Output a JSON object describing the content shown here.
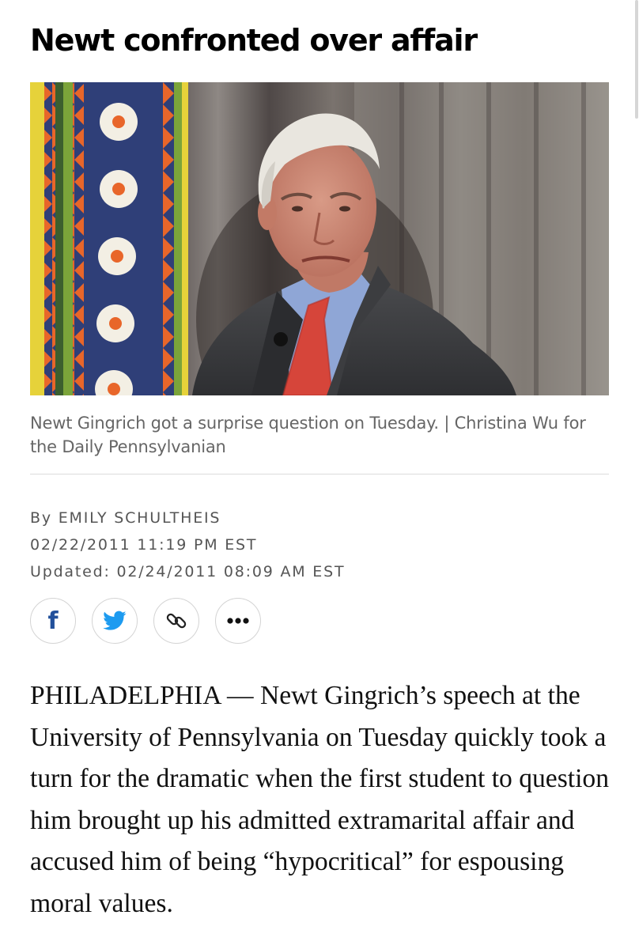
{
  "article": {
    "headline": "Newt confronted over affair",
    "image_alt": "Newt Gingrich speaking",
    "caption": "Newt Gingrich got a surprise question on Tuesday. | Christina Wu for the Daily Pennsylvanian",
    "byline": "By EMILY SCHULTHEIS",
    "published": "02/22/2011 11:19 PM EST",
    "updated": "Updated: 02/24/2011 08:09 AM EST",
    "body": "PHILADELPHIA — Newt Gingrich’s speech at the University of Pennsylvania on Tuesday quickly took a turn for the dramatic when the first student to question him brought up his admitted extramarital affair and accused him of being “hypocritical” for espousing moral values."
  },
  "share": {
    "facebook_icon": "facebook-icon",
    "facebook_glyph": "f",
    "twitter_icon": "twitter-icon",
    "link_icon": "link-icon",
    "more_icon": "more-icon"
  },
  "colors": {
    "facebook": "#22509b",
    "twitter": "#1d9bf0",
    "caption_text": "#666666",
    "meta_text": "#555555"
  }
}
